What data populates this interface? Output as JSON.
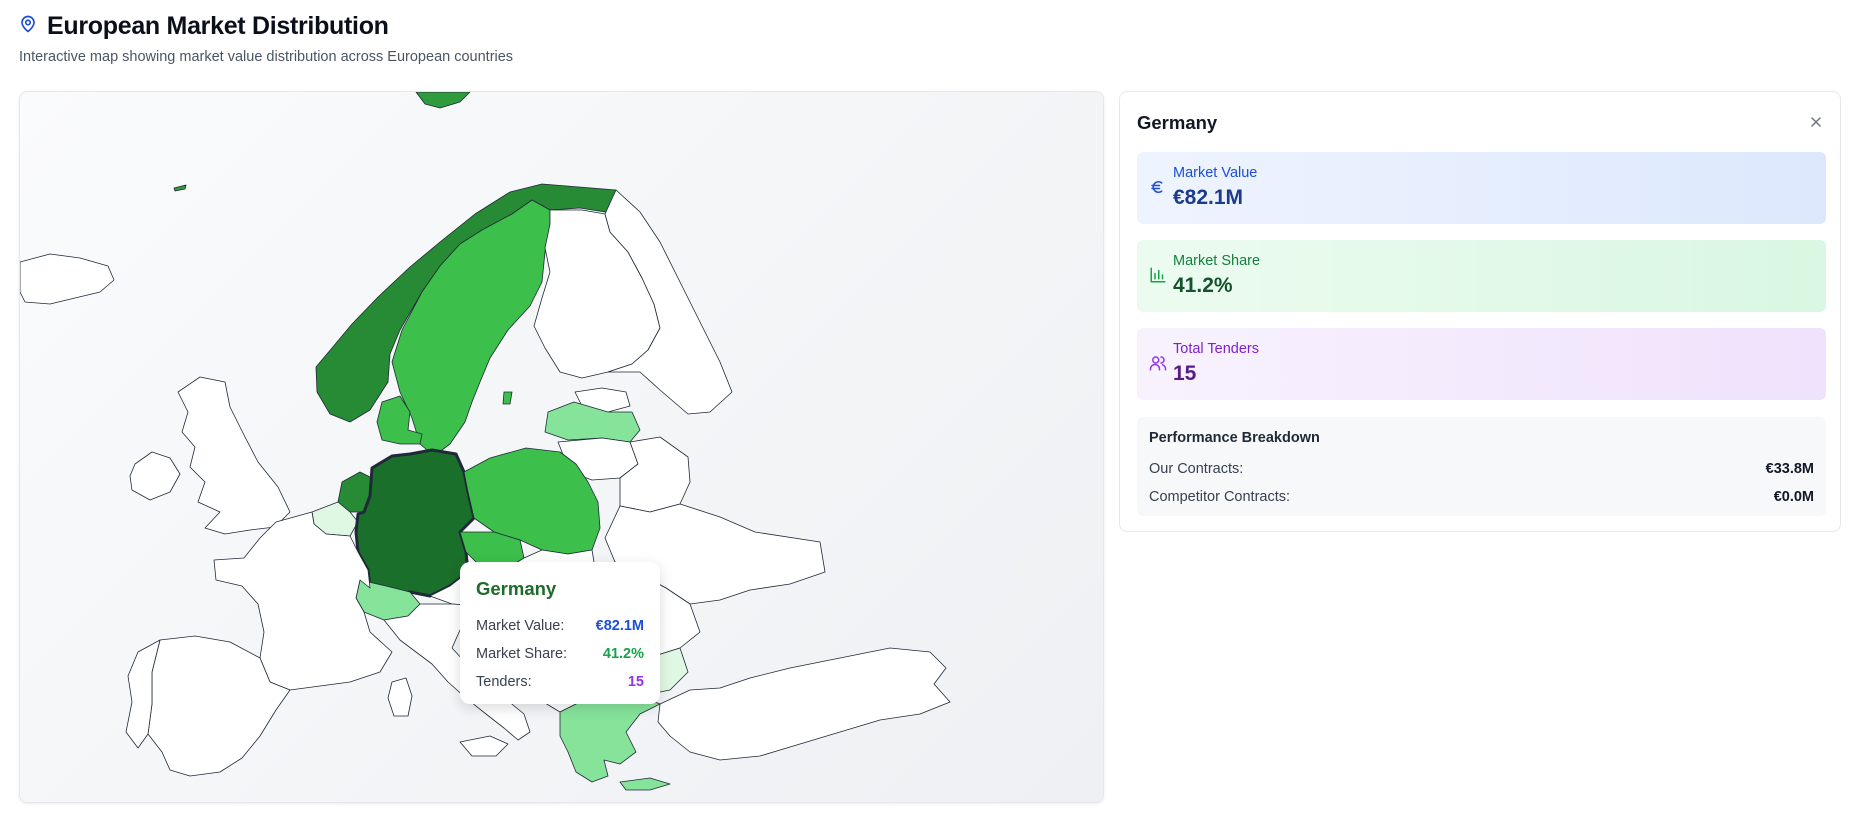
{
  "header": {
    "title": "European Market Distribution",
    "subtitle": "Interactive map showing market value distribution across European countries"
  },
  "map": {
    "scale": {
      "low": "#dcfce7",
      "mid": "#34c24a",
      "high": "#1a6f2a"
    },
    "countries": [
      {
        "name": "Germany",
        "level": "highest",
        "selected": true
      },
      {
        "name": "Netherlands",
        "level": "high"
      },
      {
        "name": "Norway",
        "level": "high"
      },
      {
        "name": "Sweden",
        "level": "medium"
      },
      {
        "name": "Poland",
        "level": "medium"
      },
      {
        "name": "Czechia",
        "level": "medium"
      },
      {
        "name": "Denmark",
        "level": "medium"
      },
      {
        "name": "Latvia",
        "level": "low"
      },
      {
        "name": "Switzerland",
        "level": "low"
      },
      {
        "name": "Greece",
        "level": "low"
      },
      {
        "name": "Belgium",
        "level": "very-low"
      },
      {
        "name": "Bulgaria",
        "level": "very-low"
      }
    ]
  },
  "tooltip": {
    "country": "Germany",
    "market_value_label": "Market Value:",
    "market_value": "€82.1M",
    "market_share_label": "Market Share:",
    "market_share": "41.2%",
    "tenders_label": "Tenders:",
    "tenders": "15"
  },
  "panel": {
    "title": "Germany",
    "market_value_label": "Market Value",
    "market_value": "€82.1M",
    "market_share_label": "Market Share",
    "market_share": "41.2%",
    "total_tenders_label": "Total Tenders",
    "total_tenders": "15",
    "performance_title": "Performance Breakdown",
    "our_contracts_label": "Our Contracts:",
    "our_contracts": "€33.8M",
    "competitor_contracts_label": "Competitor Contracts:",
    "competitor_contracts": "€0.0M"
  },
  "colors": {
    "blue": "#1d4ed8",
    "green": "#16a34a",
    "purple": "#9333ea"
  }
}
